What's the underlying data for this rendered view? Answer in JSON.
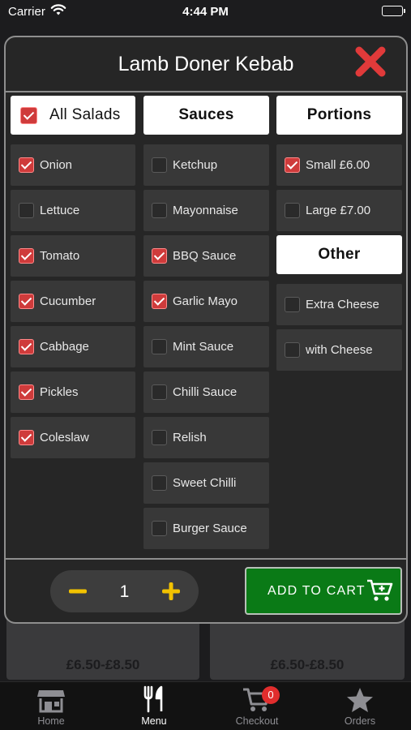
{
  "status_bar": {
    "carrier": "Carrier",
    "time": "4:44 PM"
  },
  "background": {
    "card_prices": [
      "£6.50-£8.50",
      "£6.50-£8.50"
    ]
  },
  "modal": {
    "title": "Lamb Doner Kebab",
    "salads": {
      "header": "All Salads",
      "header_checked": true,
      "items": [
        {
          "label": "Onion",
          "checked": true
        },
        {
          "label": "Lettuce",
          "checked": false
        },
        {
          "label": "Tomato",
          "checked": true
        },
        {
          "label": "Cucumber",
          "checked": true
        },
        {
          "label": "Cabbage",
          "checked": true
        },
        {
          "label": "Pickles",
          "checked": true
        },
        {
          "label": "Coleslaw",
          "checked": true
        }
      ]
    },
    "sauces": {
      "header": "Sauces",
      "items": [
        {
          "label": "Ketchup",
          "checked": false
        },
        {
          "label": "Mayonnaise",
          "checked": false
        },
        {
          "label": "BBQ Sauce",
          "checked": true
        },
        {
          "label": "Garlic Mayo",
          "checked": true
        },
        {
          "label": "Mint Sauce",
          "checked": false
        },
        {
          "label": "Chilli Sauce",
          "checked": false
        },
        {
          "label": "Relish",
          "checked": false
        },
        {
          "label": "Sweet Chilli",
          "checked": false
        },
        {
          "label": "Burger Sauce",
          "checked": false
        }
      ]
    },
    "portions": {
      "header": "Portions",
      "items": [
        {
          "label": "Small £6.00",
          "checked": true
        },
        {
          "label": "Large £7.00",
          "checked": false
        }
      ]
    },
    "other": {
      "header": "Other",
      "items": [
        {
          "label": "Extra Cheese",
          "checked": false
        },
        {
          "label": "with Cheese",
          "checked": false
        }
      ]
    },
    "quantity": "1",
    "add_to_cart_label": "ADD TO CART"
  },
  "tabbar": {
    "items": [
      {
        "label": "Home",
        "icon": "store-icon",
        "active": false
      },
      {
        "label": "Menu",
        "icon": "fork-knife-icon",
        "active": true
      },
      {
        "label": "Checkout",
        "icon": "cart-icon",
        "active": false,
        "badge": "0"
      },
      {
        "label": "Orders",
        "icon": "star-icon",
        "active": false
      }
    ]
  },
  "colors": {
    "accent_checked": "#cf3b3b",
    "add_to_cart": "#0a7a16",
    "qty_icons": "#f2c200",
    "close_icon": "#e03a3a",
    "badge": "#e12d2d"
  }
}
